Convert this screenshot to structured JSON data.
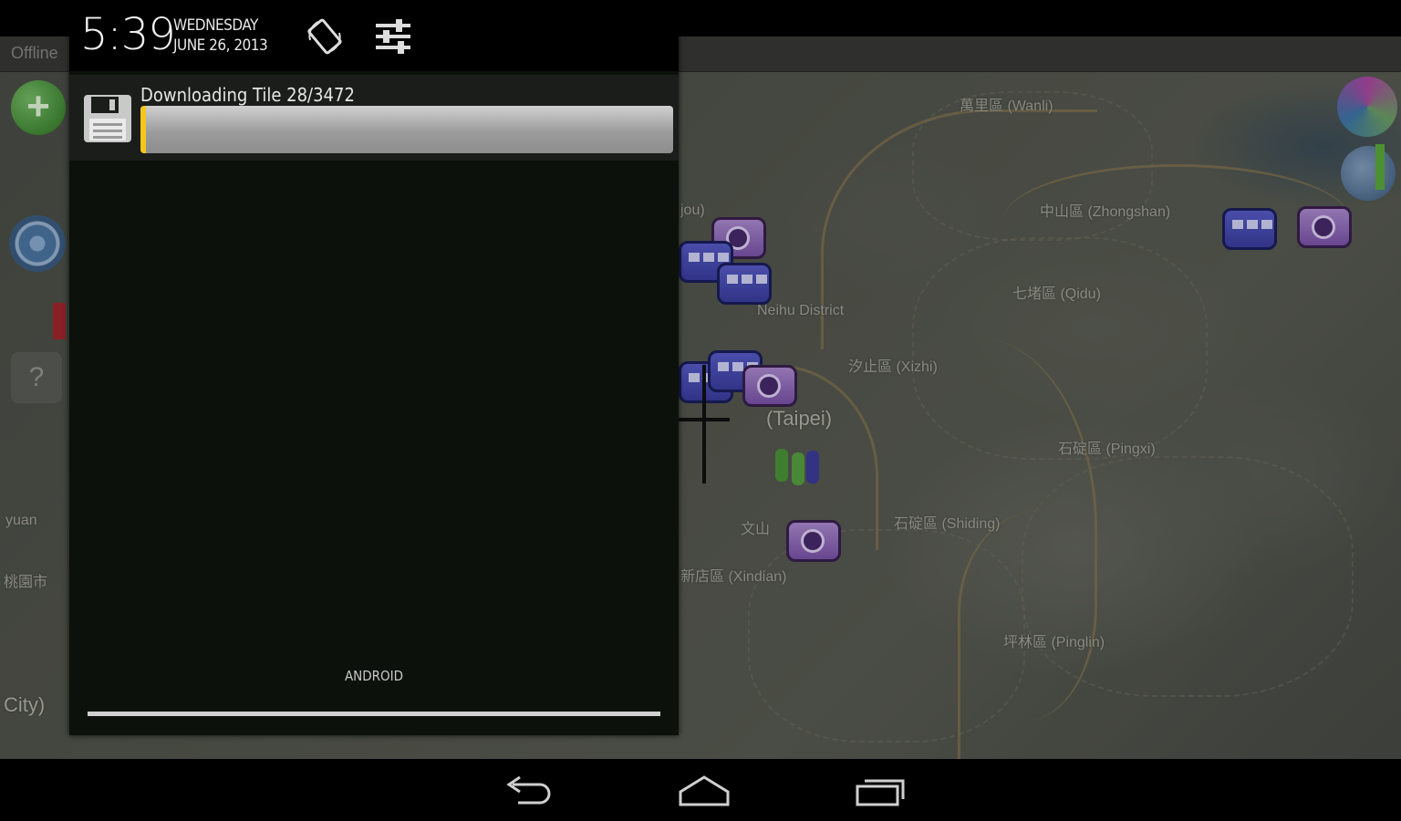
{
  "status": {
    "time": "5:39",
    "day": "WEDNESDAY",
    "date": "JUNE 26, 2013",
    "rotate_icon": "auto-rotate-icon",
    "settings_icon": "quick-settings-icon"
  },
  "notification": {
    "icon": "floppy-disk-icon",
    "title": "Downloading Tile 28/3472",
    "progress_fraction": 0.008,
    "accent_color": "#f6c61a"
  },
  "carrier": "ANDROID",
  "map": {
    "title": "Offline",
    "places": [
      {
        "label": "萬里區 (Wanli)"
      },
      {
        "label": "中山區 (Zhongshan)"
      },
      {
        "label": "七堵區 (Qidu)"
      },
      {
        "label": "Neihu District"
      },
      {
        "label": "汐止區 (Xizhi)"
      },
      {
        "label": "(Taipei)"
      },
      {
        "label": "石碇區 (Pingxi)"
      },
      {
        "label": "石碇區 (Shiding)"
      },
      {
        "label": "新店區 (Xindian)"
      },
      {
        "label": "坪林區 (Pinglin)"
      },
      {
        "label": "文山"
      },
      {
        "label": "jou)"
      },
      {
        "label": "yuan"
      },
      {
        "label": "桃園市"
      },
      {
        "label": "City)"
      }
    ]
  },
  "nav": {
    "back": "back-icon",
    "home": "home-icon",
    "recents": "recent-apps-icon"
  }
}
